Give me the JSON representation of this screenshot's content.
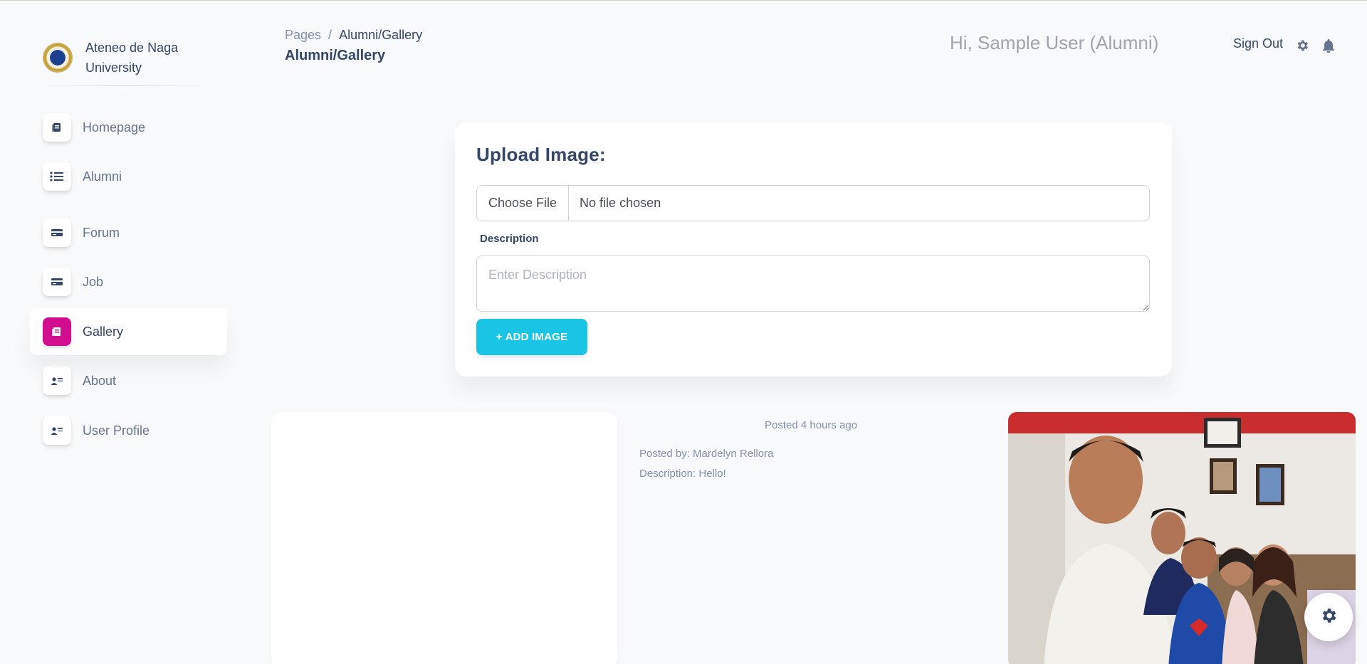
{
  "sidebar": {
    "brand_name": "Ateneo de Naga University",
    "items": [
      {
        "label": "Homepage",
        "icon": "document-icon"
      },
      {
        "label": "Alumni",
        "icon": "list-icon"
      },
      {
        "label": "Forum",
        "icon": "credit-card-icon"
      },
      {
        "label": "Job",
        "icon": "credit-card-icon"
      },
      {
        "label": "Gallery",
        "icon": "document-icon",
        "active": true
      },
      {
        "label": "About",
        "icon": "user-card-icon"
      },
      {
        "label": "User Profile",
        "icon": "user-card-icon"
      }
    ],
    "active_color": "#d10f8e"
  },
  "header": {
    "breadcrumb_root": "Pages",
    "breadcrumb_sep": "/",
    "breadcrumb_current": "Alumni/Gallery",
    "title": "Alumni/Gallery",
    "greeting": "Hi, Sample User (Alumni)",
    "signout": "Sign Out"
  },
  "upload": {
    "title": "Upload Image:",
    "choose_file": "Choose File",
    "file_status": "No file chosen",
    "description_label": "Description",
    "description_placeholder": "Enter Description",
    "add_button": "+ ADD IMAGE",
    "button_color": "#1ac4e4"
  },
  "post": {
    "time": "Posted 4 hours ago",
    "posted_by": "Posted by: Mardelyn Rellora",
    "description": "Description: Hello!"
  }
}
